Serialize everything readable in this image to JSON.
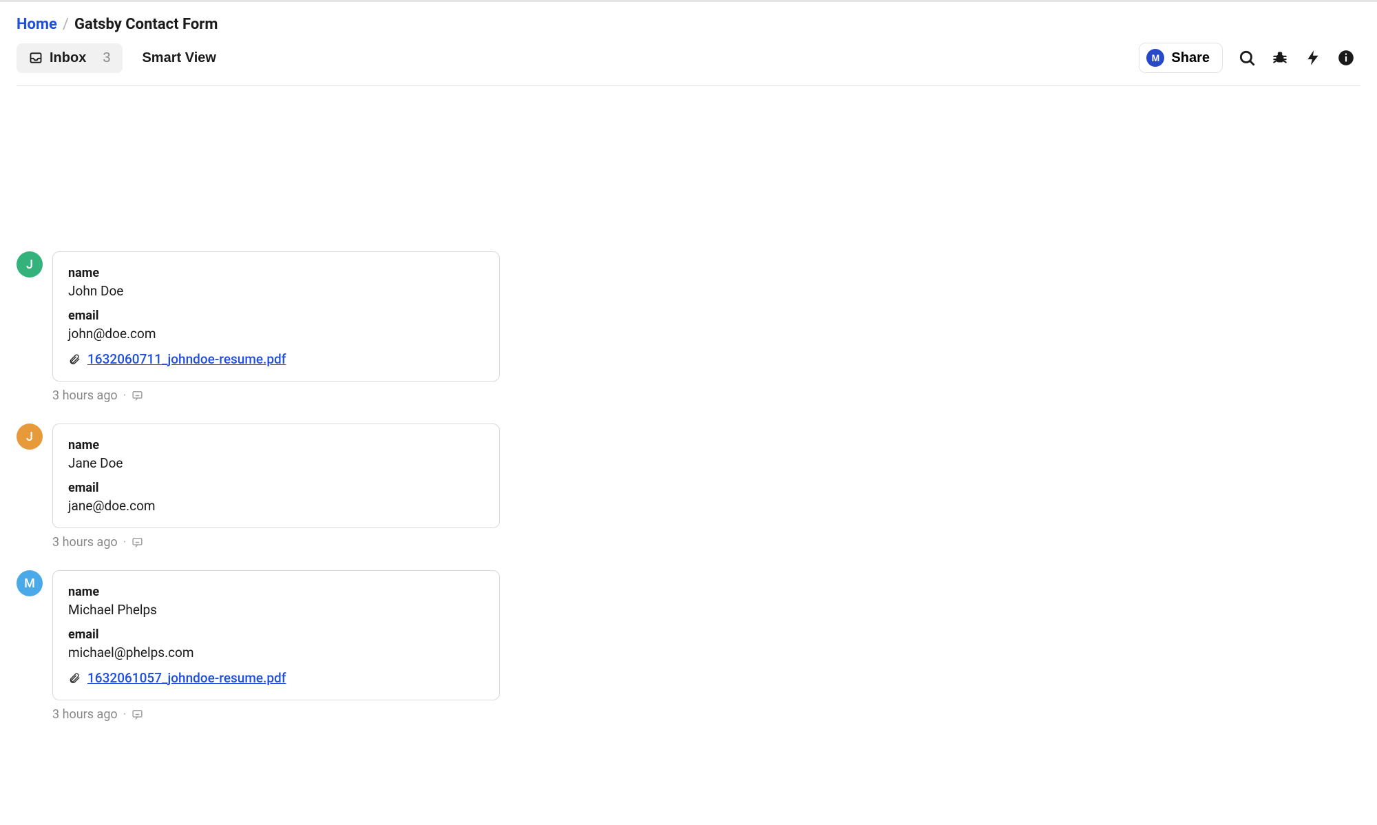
{
  "breadcrumb": {
    "home": "Home",
    "current": "Gatsby Contact Form"
  },
  "toolbar": {
    "inbox_label": "Inbox",
    "inbox_count": "3",
    "smart_view_label": "Smart View",
    "share_label": "Share",
    "share_initial": "M"
  },
  "labels": {
    "name": "name",
    "email": "email"
  },
  "avatar_colors": {
    "0": "av-green",
    "1": "av-orange",
    "2": "av-blue"
  },
  "entries": [
    {
      "initial": "J",
      "name": "John Doe",
      "email": "john@doe.com",
      "attachment": "1632060711_johndoe-resume.pdf",
      "time": "3 hours ago"
    },
    {
      "initial": "J",
      "name": "Jane Doe",
      "email": "jane@doe.com",
      "attachment": null,
      "time": "3 hours ago"
    },
    {
      "initial": "M",
      "name": "Michael Phelps",
      "email": "michael@phelps.com",
      "attachment": "1632061057_johndoe-resume.pdf",
      "time": "3 hours ago"
    }
  ]
}
